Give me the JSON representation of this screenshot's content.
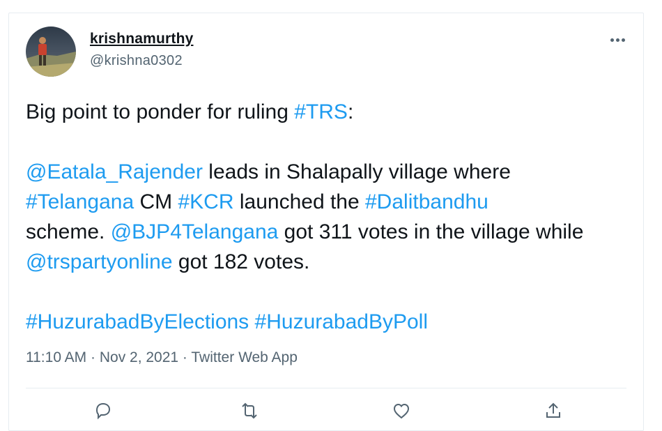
{
  "author": {
    "display_name": "krishnamurthy",
    "handle": "@krishna0302"
  },
  "tweet": {
    "line1": {
      "text_before": "Big point to ponder for ruling ",
      "hashtag": "#TRS",
      "text_after": ":"
    },
    "para2": {
      "mention1": "@Eatala_Rajender",
      "t1": " leads in Shalapally village where ",
      "hashtag1": "#Telangana",
      "t2": " CM ",
      "hashtag2": "#KCR",
      "t3": " launched the ",
      "hashtag3": "#Dalitbandhu",
      "t4": " scheme. ",
      "mention2": "@BJP4Telangana",
      "t5": " got 311 votes in the village while ",
      "mention3": "@trspartyonline",
      "t6": " got 182 votes."
    },
    "para3": {
      "hashtag1": "#HuzurabadByElections",
      "space": " ",
      "hashtag2": "#HuzurabadByPoll"
    }
  },
  "meta": {
    "time": "11:10 AM",
    "separator1": " · ",
    "date": "Nov 2, 2021",
    "separator2": " · ",
    "source": "Twitter Web App"
  },
  "icons": {
    "more": "more-horizontal-icon",
    "reply": "reply-icon",
    "retweet": "retweet-icon",
    "like": "heart-icon",
    "share": "share-icon"
  },
  "colors": {
    "link": "#1d9bf0",
    "text": "#0f1419",
    "secondary": "#536471",
    "border": "#e6ecf0"
  }
}
